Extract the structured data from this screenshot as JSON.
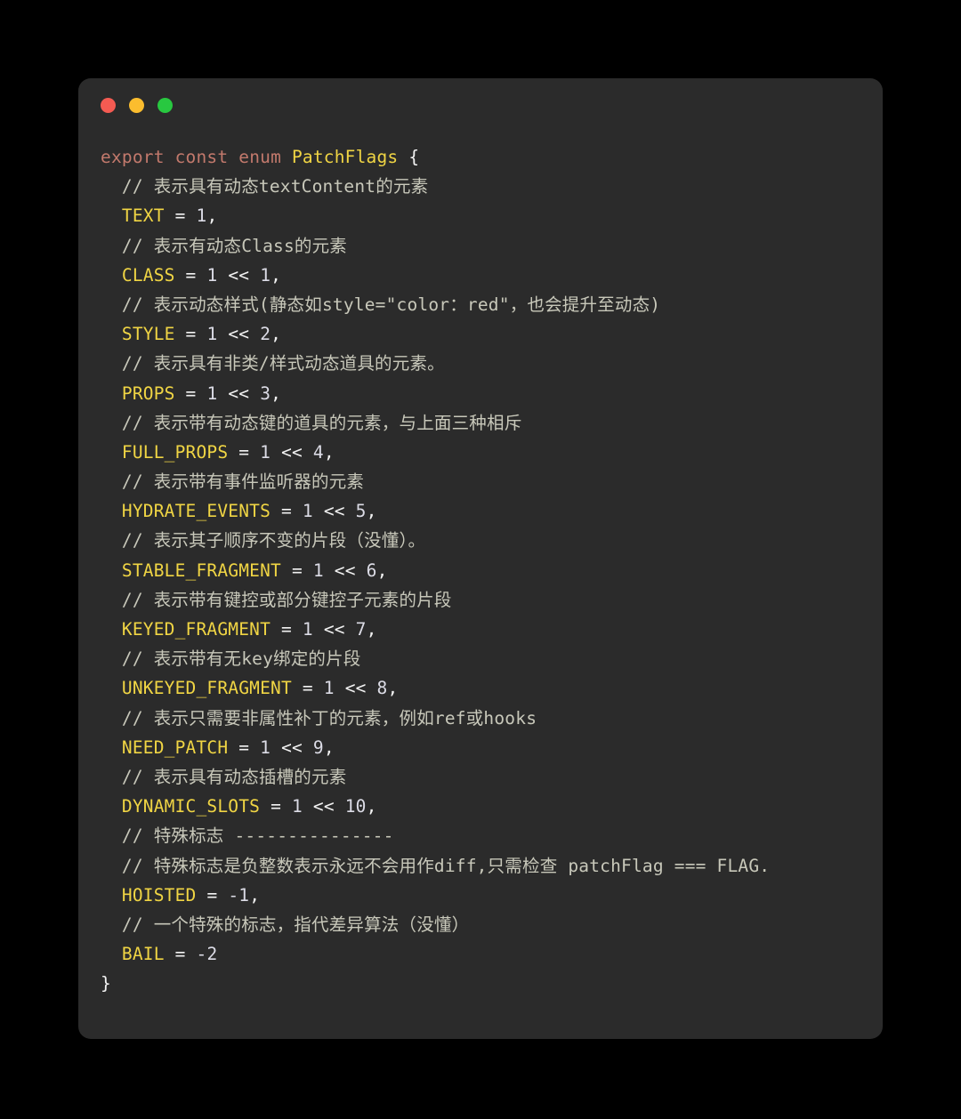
{
  "window": {
    "background": "#2b2b2b",
    "page_background": "#000000",
    "controls": [
      {
        "name": "close",
        "color": "#f45b52"
      },
      {
        "name": "minimize",
        "color": "#fbbd2e"
      },
      {
        "name": "maximize",
        "color": "#28c840"
      }
    ]
  },
  "theme": {
    "keyword": "#c2796c",
    "type_name": "#f0d544",
    "enum_member": "#f0d544",
    "number": "#dcdce6",
    "operator": "#f2f2f2",
    "comment": "#c8c8ba",
    "punctuation": "#f2f2f2"
  },
  "code": {
    "language": "typescript",
    "lines": [
      {
        "indent": 0,
        "tokens": [
          {
            "t": "kw",
            "v": "export"
          },
          {
            "t": "sp",
            "v": " "
          },
          {
            "t": "kw",
            "v": "const"
          },
          {
            "t": "sp",
            "v": " "
          },
          {
            "t": "kw",
            "v": "enum"
          },
          {
            "t": "sp",
            "v": " "
          },
          {
            "t": "type",
            "v": "PatchFlags"
          },
          {
            "t": "sp",
            "v": " "
          },
          {
            "t": "brace",
            "v": "{"
          }
        ]
      },
      {
        "indent": 1,
        "tokens": [
          {
            "t": "cmt",
            "v": "// 表示具有动态textContent的元素"
          }
        ]
      },
      {
        "indent": 1,
        "tokens": [
          {
            "t": "name",
            "v": "TEXT"
          },
          {
            "t": "sp",
            "v": " "
          },
          {
            "t": "op",
            "v": "="
          },
          {
            "t": "sp",
            "v": " "
          },
          {
            "t": "num",
            "v": "1"
          },
          {
            "t": "punct",
            "v": ","
          }
        ]
      },
      {
        "indent": 1,
        "tokens": [
          {
            "t": "cmt",
            "v": "// 表示有动态Class的元素"
          }
        ]
      },
      {
        "indent": 1,
        "tokens": [
          {
            "t": "name",
            "v": "CLASS"
          },
          {
            "t": "sp",
            "v": " "
          },
          {
            "t": "op",
            "v": "="
          },
          {
            "t": "sp",
            "v": " "
          },
          {
            "t": "num",
            "v": "1"
          },
          {
            "t": "sp",
            "v": " "
          },
          {
            "t": "op",
            "v": "<<"
          },
          {
            "t": "sp",
            "v": " "
          },
          {
            "t": "num",
            "v": "1"
          },
          {
            "t": "punct",
            "v": ","
          }
        ]
      },
      {
        "indent": 1,
        "tokens": [
          {
            "t": "cmt",
            "v": "// 表示动态样式(静态如style=\"color：red\"，也会提升至动态)"
          }
        ]
      },
      {
        "indent": 1,
        "tokens": [
          {
            "t": "name",
            "v": "STYLE"
          },
          {
            "t": "sp",
            "v": " "
          },
          {
            "t": "op",
            "v": "="
          },
          {
            "t": "sp",
            "v": " "
          },
          {
            "t": "num",
            "v": "1"
          },
          {
            "t": "sp",
            "v": " "
          },
          {
            "t": "op",
            "v": "<<"
          },
          {
            "t": "sp",
            "v": " "
          },
          {
            "t": "num",
            "v": "2"
          },
          {
            "t": "punct",
            "v": ","
          }
        ]
      },
      {
        "indent": 1,
        "tokens": [
          {
            "t": "cmt",
            "v": "// 表示具有非类/样式动态道具的元素。"
          }
        ]
      },
      {
        "indent": 1,
        "tokens": [
          {
            "t": "name",
            "v": "PROPS"
          },
          {
            "t": "sp",
            "v": " "
          },
          {
            "t": "op",
            "v": "="
          },
          {
            "t": "sp",
            "v": " "
          },
          {
            "t": "num",
            "v": "1"
          },
          {
            "t": "sp",
            "v": " "
          },
          {
            "t": "op",
            "v": "<<"
          },
          {
            "t": "sp",
            "v": " "
          },
          {
            "t": "num",
            "v": "3"
          },
          {
            "t": "punct",
            "v": ","
          }
        ]
      },
      {
        "indent": 1,
        "tokens": [
          {
            "t": "cmt",
            "v": "// 表示带有动态键的道具的元素，与上面三种相斥"
          }
        ]
      },
      {
        "indent": 1,
        "tokens": [
          {
            "t": "name",
            "v": "FULL_PROPS"
          },
          {
            "t": "sp",
            "v": " "
          },
          {
            "t": "op",
            "v": "="
          },
          {
            "t": "sp",
            "v": " "
          },
          {
            "t": "num",
            "v": "1"
          },
          {
            "t": "sp",
            "v": " "
          },
          {
            "t": "op",
            "v": "<<"
          },
          {
            "t": "sp",
            "v": " "
          },
          {
            "t": "num",
            "v": "4"
          },
          {
            "t": "punct",
            "v": ","
          }
        ]
      },
      {
        "indent": 1,
        "tokens": [
          {
            "t": "cmt",
            "v": "// 表示带有事件监听器的元素"
          }
        ]
      },
      {
        "indent": 1,
        "tokens": [
          {
            "t": "name",
            "v": "HYDRATE_EVENTS"
          },
          {
            "t": "sp",
            "v": " "
          },
          {
            "t": "op",
            "v": "="
          },
          {
            "t": "sp",
            "v": " "
          },
          {
            "t": "num",
            "v": "1"
          },
          {
            "t": "sp",
            "v": " "
          },
          {
            "t": "op",
            "v": "<<"
          },
          {
            "t": "sp",
            "v": " "
          },
          {
            "t": "num",
            "v": "5"
          },
          {
            "t": "punct",
            "v": ","
          }
        ]
      },
      {
        "indent": 1,
        "tokens": [
          {
            "t": "cmt",
            "v": "// 表示其子顺序不变的片段（没懂）。"
          }
        ]
      },
      {
        "indent": 1,
        "tokens": [
          {
            "t": "name",
            "v": "STABLE_FRAGMENT"
          },
          {
            "t": "sp",
            "v": " "
          },
          {
            "t": "op",
            "v": "="
          },
          {
            "t": "sp",
            "v": " "
          },
          {
            "t": "num",
            "v": "1"
          },
          {
            "t": "sp",
            "v": " "
          },
          {
            "t": "op",
            "v": "<<"
          },
          {
            "t": "sp",
            "v": " "
          },
          {
            "t": "num",
            "v": "6"
          },
          {
            "t": "punct",
            "v": ","
          }
        ]
      },
      {
        "indent": 1,
        "tokens": [
          {
            "t": "cmt",
            "v": "// 表示带有键控或部分键控子元素的片段"
          }
        ]
      },
      {
        "indent": 1,
        "tokens": [
          {
            "t": "name",
            "v": "KEYED_FRAGMENT"
          },
          {
            "t": "sp",
            "v": " "
          },
          {
            "t": "op",
            "v": "="
          },
          {
            "t": "sp",
            "v": " "
          },
          {
            "t": "num",
            "v": "1"
          },
          {
            "t": "sp",
            "v": " "
          },
          {
            "t": "op",
            "v": "<<"
          },
          {
            "t": "sp",
            "v": " "
          },
          {
            "t": "num",
            "v": "7"
          },
          {
            "t": "punct",
            "v": ","
          }
        ]
      },
      {
        "indent": 1,
        "tokens": [
          {
            "t": "cmt",
            "v": "// 表示带有无key绑定的片段"
          }
        ]
      },
      {
        "indent": 1,
        "tokens": [
          {
            "t": "name",
            "v": "UNKEYED_FRAGMENT"
          },
          {
            "t": "sp",
            "v": " "
          },
          {
            "t": "op",
            "v": "="
          },
          {
            "t": "sp",
            "v": " "
          },
          {
            "t": "num",
            "v": "1"
          },
          {
            "t": "sp",
            "v": " "
          },
          {
            "t": "op",
            "v": "<<"
          },
          {
            "t": "sp",
            "v": " "
          },
          {
            "t": "num",
            "v": "8"
          },
          {
            "t": "punct",
            "v": ","
          }
        ]
      },
      {
        "indent": 1,
        "tokens": [
          {
            "t": "cmt",
            "v": "// 表示只需要非属性补丁的元素，例如ref或hooks"
          }
        ]
      },
      {
        "indent": 1,
        "tokens": [
          {
            "t": "name",
            "v": "NEED_PATCH"
          },
          {
            "t": "sp",
            "v": " "
          },
          {
            "t": "op",
            "v": "="
          },
          {
            "t": "sp",
            "v": " "
          },
          {
            "t": "num",
            "v": "1"
          },
          {
            "t": "sp",
            "v": " "
          },
          {
            "t": "op",
            "v": "<<"
          },
          {
            "t": "sp",
            "v": " "
          },
          {
            "t": "num",
            "v": "9"
          },
          {
            "t": "punct",
            "v": ","
          }
        ]
      },
      {
        "indent": 1,
        "tokens": [
          {
            "t": "cmt",
            "v": "// 表示具有动态插槽的元素"
          }
        ]
      },
      {
        "indent": 1,
        "tokens": [
          {
            "t": "name",
            "v": "DYNAMIC_SLOTS"
          },
          {
            "t": "sp",
            "v": " "
          },
          {
            "t": "op",
            "v": "="
          },
          {
            "t": "sp",
            "v": " "
          },
          {
            "t": "num",
            "v": "1"
          },
          {
            "t": "sp",
            "v": " "
          },
          {
            "t": "op",
            "v": "<<"
          },
          {
            "t": "sp",
            "v": " "
          },
          {
            "t": "num",
            "v": "10"
          },
          {
            "t": "punct",
            "v": ","
          }
        ]
      },
      {
        "indent": 1,
        "tokens": [
          {
            "t": "cmt",
            "v": "// 特殊标志 ---------------"
          }
        ]
      },
      {
        "indent": 1,
        "tokens": [
          {
            "t": "cmt",
            "v": "// 特殊标志是负整数表示永远不会用作diff,只需检查 patchFlag === FLAG."
          }
        ]
      },
      {
        "indent": 1,
        "tokens": [
          {
            "t": "name",
            "v": "HOISTED"
          },
          {
            "t": "sp",
            "v": " "
          },
          {
            "t": "op",
            "v": "="
          },
          {
            "t": "sp",
            "v": " "
          },
          {
            "t": "num",
            "v": "-1"
          },
          {
            "t": "punct",
            "v": ","
          }
        ]
      },
      {
        "indent": 1,
        "tokens": [
          {
            "t": "cmt",
            "v": "// 一个特殊的标志，指代差异算法（没懂）"
          }
        ]
      },
      {
        "indent": 1,
        "tokens": [
          {
            "t": "name",
            "v": "BAIL"
          },
          {
            "t": "sp",
            "v": " "
          },
          {
            "t": "op",
            "v": "="
          },
          {
            "t": "sp",
            "v": " "
          },
          {
            "t": "num",
            "v": "-2"
          }
        ]
      },
      {
        "indent": 0,
        "tokens": [
          {
            "t": "brace",
            "v": "}"
          }
        ]
      }
    ]
  }
}
